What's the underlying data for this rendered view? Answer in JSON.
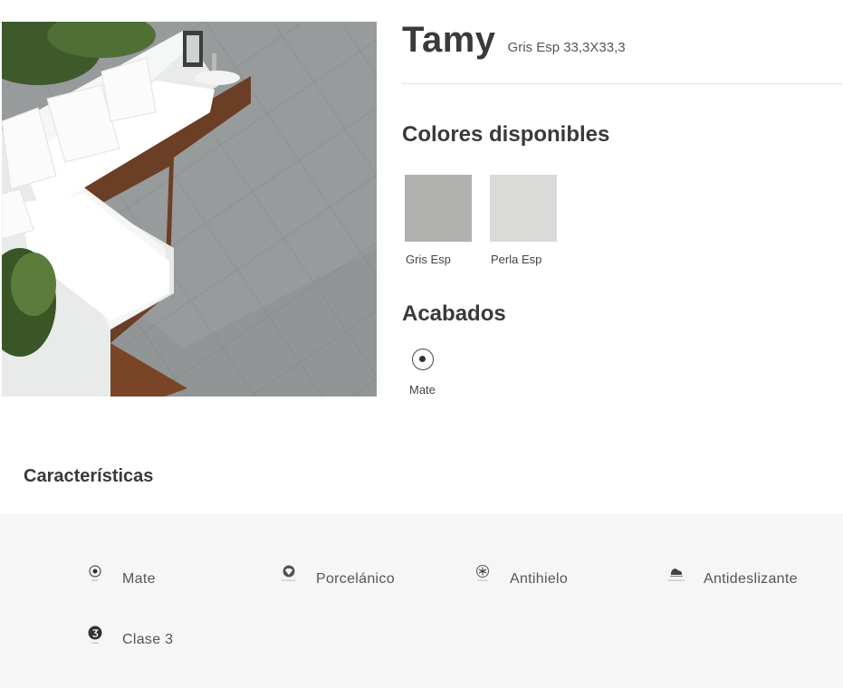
{
  "product": {
    "name": "Tamy",
    "subtitle": "Gris Esp 33,3X33,3"
  },
  "colors": {
    "title": "Colores disponibles",
    "items": [
      {
        "label": "Gris Esp",
        "hex": "#b1b2b0"
      },
      {
        "label": "Perla Esp",
        "hex": "#dadbd9"
      }
    ]
  },
  "finishes": {
    "title": "Acabados",
    "items": [
      {
        "label": "Mate",
        "icon": "matte-dot-icon"
      }
    ]
  },
  "characteristics": {
    "title": "Características",
    "items": [
      {
        "label": "Mate",
        "icon": "matte-dot-icon"
      },
      {
        "label": "Porcelánico",
        "icon": "porcelain-diamond-icon"
      },
      {
        "label": "Antihielo",
        "icon": "snowflake-icon"
      },
      {
        "label": "Antideslizante",
        "icon": "non-slip-shoe-icon"
      },
      {
        "label": "Clase 3",
        "icon": "class-3-badge-icon"
      }
    ]
  },
  "theme": {
    "text": "#3a3a3a",
    "panel_background": "#f6f6f6"
  }
}
